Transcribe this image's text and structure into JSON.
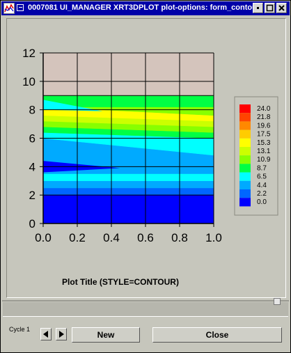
{
  "window": {
    "title": "0007081 UI_MANAGER XRT3DPLOT plot-options: form_contour"
  },
  "chart_data": {
    "type": "contour",
    "title": "Plot Title (STYLE=CONTOUR)",
    "x_ticks": [
      "0.0",
      "0.2",
      "0.4",
      "0.6",
      "0.8",
      "1.0"
    ],
    "y_ticks": [
      "0",
      "2",
      "4",
      "6",
      "8",
      "10",
      "12"
    ],
    "xlim": [
      0,
      1
    ],
    "ylim": [
      0,
      12
    ],
    "grid": true,
    "legend_position": "right",
    "no_data_color": "#d4c4bc",
    "data_y_max": 9,
    "legend": [
      {
        "label": "24.0",
        "color": "#ff0000"
      },
      {
        "label": "21.8",
        "color": "#ff4400"
      },
      {
        "label": "19.6",
        "color": "#ff8800"
      },
      {
        "label": "17.5",
        "color": "#ffcc00"
      },
      {
        "label": "15.3",
        "color": "#ffff00"
      },
      {
        "label": "13.1",
        "color": "#ccff00"
      },
      {
        "label": "10.9",
        "color": "#88ff00"
      },
      {
        "label": "8.7",
        "color": "#00ff44"
      },
      {
        "label": "6.5",
        "color": "#00ffff"
      },
      {
        "label": "4.4",
        "color": "#00aaff"
      },
      {
        "label": "2.2",
        "color": "#0066ff"
      },
      {
        "label": "0.0",
        "color": "#0000ff"
      }
    ],
    "bands": [
      {
        "y_bottom": [
          0.0,
          0.0
        ],
        "y_top": [
          2.0,
          2.0
        ],
        "color": "#0000ff"
      },
      {
        "y_bottom": [
          2.0,
          2.0
        ],
        "y_top": [
          2.5,
          2.5
        ],
        "color": "#0066ff"
      },
      {
        "y_bottom": [
          2.5,
          2.5
        ],
        "y_top": [
          3.0,
          3.0
        ],
        "color": "#00aaff"
      },
      {
        "y_bottom": [
          3.0,
          3.0
        ],
        "y_top": [
          3.5,
          3.5
        ],
        "color": "#00ffff"
      },
      {
        "y_bottom": [
          3.5,
          3.5
        ],
        "y_top": [
          6.0,
          4.8
        ],
        "color": "#00aaff"
      },
      {
        "y_bottom": [
          6.0,
          4.8
        ],
        "y_top": [
          6.4,
          6.0
        ],
        "color": "#00ffff"
      },
      {
        "y_bottom": [
          6.4,
          6.0
        ],
        "y_top": [
          6.8,
          6.4
        ],
        "color": "#00ff44"
      },
      {
        "y_bottom": [
          6.8,
          6.4
        ],
        "y_top": [
          7.2,
          6.8
        ],
        "color": "#88ff00"
      },
      {
        "y_bottom": [
          7.2,
          6.8
        ],
        "y_top": [
          7.6,
          7.2
        ],
        "color": "#ccff00"
      },
      {
        "y_bottom": [
          7.6,
          7.2
        ],
        "y_top": [
          8.2,
          7.6
        ],
        "color": "#ffff00"
      },
      {
        "y_bottom": [
          8.2,
          7.6
        ],
        "y_top": [
          9.0,
          8.2
        ],
        "color": "#88ff00"
      },
      {
        "y_bottom": [
          8.2,
          8.2
        ],
        "y_top": [
          9.0,
          9.0
        ],
        "color": "#00ff44"
      }
    ],
    "inner_bands": [
      {
        "points": [
          [
            0.0,
            4.4
          ],
          [
            0.45,
            3.9
          ],
          [
            0.0,
            3.6
          ]
        ],
        "color": "#0000ff"
      },
      {
        "points": [
          [
            0.0,
            8.0
          ],
          [
            0.35,
            7.9
          ],
          [
            0.0,
            8.7
          ]
        ],
        "color": "#00ffff"
      }
    ]
  },
  "controls": {
    "cycle_label": "Cycle 1",
    "new_label": "New",
    "close_label": "Close"
  }
}
